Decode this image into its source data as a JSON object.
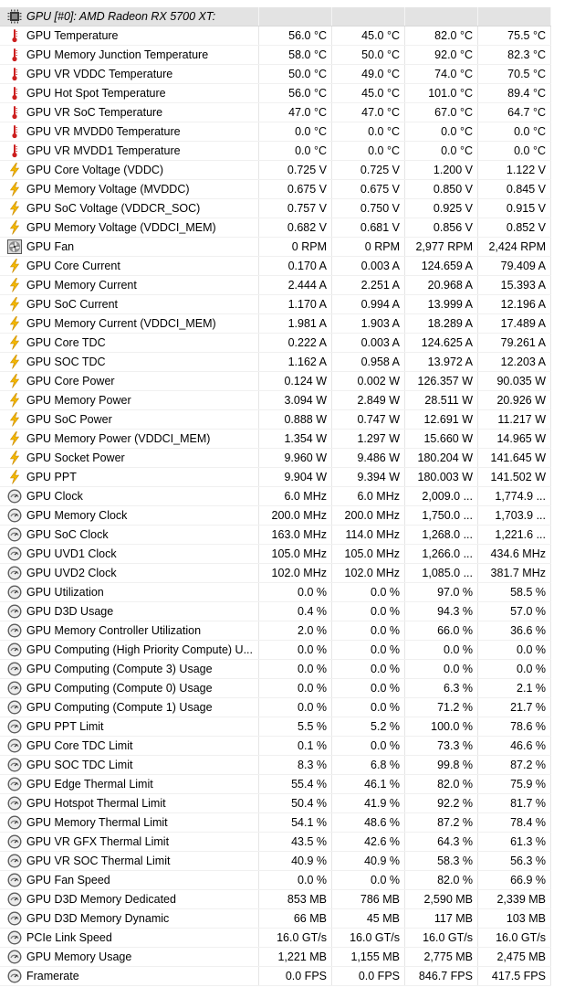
{
  "header": {
    "label": "GPU [#0]: AMD Radeon RX 5700 XT:",
    "icon": "chip-icon"
  },
  "rows": [
    {
      "icon": "thermometer-icon",
      "label": "GPU Temperature",
      "values": [
        "56.0 °C",
        "45.0 °C",
        "82.0 °C",
        "75.5 °C"
      ]
    },
    {
      "icon": "thermometer-icon",
      "label": "GPU Memory Junction Temperature",
      "values": [
        "58.0 °C",
        "50.0 °C",
        "92.0 °C",
        "82.3 °C"
      ]
    },
    {
      "icon": "thermometer-icon",
      "label": "GPU VR VDDC Temperature",
      "values": [
        "50.0 °C",
        "49.0 °C",
        "74.0 °C",
        "70.5 °C"
      ]
    },
    {
      "icon": "thermometer-icon",
      "label": "GPU Hot Spot Temperature",
      "values": [
        "56.0 °C",
        "45.0 °C",
        "101.0 °C",
        "89.4 °C"
      ]
    },
    {
      "icon": "thermometer-icon",
      "label": "GPU VR SoC Temperature",
      "values": [
        "47.0 °C",
        "47.0 °C",
        "67.0 °C",
        "64.7 °C"
      ]
    },
    {
      "icon": "thermometer-icon",
      "label": "GPU VR MVDD0 Temperature",
      "values": [
        "0.0 °C",
        "0.0 °C",
        "0.0 °C",
        "0.0 °C"
      ]
    },
    {
      "icon": "thermometer-icon",
      "label": "GPU VR MVDD1 Temperature",
      "values": [
        "0.0 °C",
        "0.0 °C",
        "0.0 °C",
        "0.0 °C"
      ]
    },
    {
      "icon": "lightning-icon",
      "label": "GPU Core Voltage (VDDC)",
      "values": [
        "0.725 V",
        "0.725 V",
        "1.200 V",
        "1.122 V"
      ]
    },
    {
      "icon": "lightning-icon",
      "label": "GPU Memory Voltage (MVDDC)",
      "values": [
        "0.675 V",
        "0.675 V",
        "0.850 V",
        "0.845 V"
      ]
    },
    {
      "icon": "lightning-icon",
      "label": "GPU SoC Voltage (VDDCR_SOC)",
      "values": [
        "0.757 V",
        "0.750 V",
        "0.925 V",
        "0.915 V"
      ]
    },
    {
      "icon": "lightning-icon",
      "label": "GPU Memory Voltage (VDDCI_MEM)",
      "values": [
        "0.682 V",
        "0.681 V",
        "0.856 V",
        "0.852 V"
      ]
    },
    {
      "icon": "fan-icon",
      "label": "GPU Fan",
      "values": [
        "0 RPM",
        "0 RPM",
        "2,977 RPM",
        "2,424 RPM"
      ]
    },
    {
      "icon": "lightning-icon",
      "label": "GPU Core Current",
      "values": [
        "0.170 A",
        "0.003 A",
        "124.659 A",
        "79.409 A"
      ]
    },
    {
      "icon": "lightning-icon",
      "label": "GPU Memory Current",
      "values": [
        "2.444 A",
        "2.251 A",
        "20.968 A",
        "15.393 A"
      ]
    },
    {
      "icon": "lightning-icon",
      "label": "GPU SoC Current",
      "values": [
        "1.170 A",
        "0.994 A",
        "13.999 A",
        "12.196 A"
      ]
    },
    {
      "icon": "lightning-icon",
      "label": "GPU Memory Current (VDDCI_MEM)",
      "values": [
        "1.981 A",
        "1.903 A",
        "18.289 A",
        "17.489 A"
      ]
    },
    {
      "icon": "lightning-icon",
      "label": "GPU Core TDC",
      "values": [
        "0.222 A",
        "0.003 A",
        "124.625 A",
        "79.261 A"
      ]
    },
    {
      "icon": "lightning-icon",
      "label": "GPU SOC TDC",
      "values": [
        "1.162 A",
        "0.958 A",
        "13.972 A",
        "12.203 A"
      ]
    },
    {
      "icon": "lightning-icon",
      "label": "GPU Core Power",
      "values": [
        "0.124 W",
        "0.002 W",
        "126.357 W",
        "90.035 W"
      ]
    },
    {
      "icon": "lightning-icon",
      "label": "GPU Memory Power",
      "values": [
        "3.094 W",
        "2.849 W",
        "28.511 W",
        "20.926 W"
      ]
    },
    {
      "icon": "lightning-icon",
      "label": "GPU SoC Power",
      "values": [
        "0.888 W",
        "0.747 W",
        "12.691 W",
        "11.217 W"
      ]
    },
    {
      "icon": "lightning-icon",
      "label": "GPU Memory Power (VDDCI_MEM)",
      "values": [
        "1.354 W",
        "1.297 W",
        "15.660 W",
        "14.965 W"
      ]
    },
    {
      "icon": "lightning-icon",
      "label": "GPU Socket Power",
      "values": [
        "9.960 W",
        "9.486 W",
        "180.204 W",
        "141.645 W"
      ]
    },
    {
      "icon": "lightning-icon",
      "label": "GPU PPT",
      "values": [
        "9.904 W",
        "9.394 W",
        "180.003 W",
        "141.502 W"
      ]
    },
    {
      "icon": "gauge-icon",
      "label": "GPU Clock",
      "values": [
        "6.0 MHz",
        "6.0 MHz",
        "2,009.0 ...",
        "1,774.9 ..."
      ]
    },
    {
      "icon": "gauge-icon",
      "label": "GPU Memory Clock",
      "values": [
        "200.0 MHz",
        "200.0 MHz",
        "1,750.0 ...",
        "1,703.9 ..."
      ]
    },
    {
      "icon": "gauge-icon",
      "label": "GPU SoC Clock",
      "values": [
        "163.0 MHz",
        "114.0 MHz",
        "1,268.0 ...",
        "1,221.6 ..."
      ]
    },
    {
      "icon": "gauge-icon",
      "label": "GPU UVD1 Clock",
      "values": [
        "105.0 MHz",
        "105.0 MHz",
        "1,266.0 ...",
        "434.6 MHz"
      ]
    },
    {
      "icon": "gauge-icon",
      "label": "GPU UVD2 Clock",
      "values": [
        "102.0 MHz",
        "102.0 MHz",
        "1,085.0 ...",
        "381.7 MHz"
      ]
    },
    {
      "icon": "gauge-icon",
      "label": "GPU Utilization",
      "values": [
        "0.0 %",
        "0.0 %",
        "97.0 %",
        "58.5 %"
      ]
    },
    {
      "icon": "gauge-icon",
      "label": "GPU D3D Usage",
      "values": [
        "0.4 %",
        "0.0 %",
        "94.3 %",
        "57.0 %"
      ]
    },
    {
      "icon": "gauge-icon",
      "label": "GPU Memory Controller Utilization",
      "values": [
        "2.0 %",
        "0.0 %",
        "66.0 %",
        "36.6 %"
      ]
    },
    {
      "icon": "gauge-icon",
      "label": "GPU Computing (High Priority Compute) U...",
      "values": [
        "0.0 %",
        "0.0 %",
        "0.0 %",
        "0.0 %"
      ]
    },
    {
      "icon": "gauge-icon",
      "label": "GPU Computing (Compute 3) Usage",
      "values": [
        "0.0 %",
        "0.0 %",
        "0.0 %",
        "0.0 %"
      ]
    },
    {
      "icon": "gauge-icon",
      "label": "GPU Computing (Compute 0) Usage",
      "values": [
        "0.0 %",
        "0.0 %",
        "6.3 %",
        "2.1 %"
      ]
    },
    {
      "icon": "gauge-icon",
      "label": "GPU Computing (Compute 1) Usage",
      "values": [
        "0.0 %",
        "0.0 %",
        "71.2 %",
        "21.7 %"
      ]
    },
    {
      "icon": "gauge-icon",
      "label": "GPU PPT Limit",
      "values": [
        "5.5 %",
        "5.2 %",
        "100.0 %",
        "78.6 %"
      ]
    },
    {
      "icon": "gauge-icon",
      "label": "GPU Core TDC Limit",
      "values": [
        "0.1 %",
        "0.0 %",
        "73.3 %",
        "46.6 %"
      ]
    },
    {
      "icon": "gauge-icon",
      "label": "GPU SOC TDC Limit",
      "values": [
        "8.3 %",
        "6.8 %",
        "99.8 %",
        "87.2 %"
      ]
    },
    {
      "icon": "gauge-icon",
      "label": "GPU Edge Thermal Limit",
      "values": [
        "55.4 %",
        "46.1 %",
        "82.0 %",
        "75.9 %"
      ]
    },
    {
      "icon": "gauge-icon",
      "label": "GPU Hotspot Thermal Limit",
      "values": [
        "50.4 %",
        "41.9 %",
        "92.2 %",
        "81.7 %"
      ]
    },
    {
      "icon": "gauge-icon",
      "label": "GPU Memory Thermal Limit",
      "values": [
        "54.1 %",
        "48.6 %",
        "87.2 %",
        "78.4 %"
      ]
    },
    {
      "icon": "gauge-icon",
      "label": "GPU VR GFX Thermal Limit",
      "values": [
        "43.5 %",
        "42.6 %",
        "64.3 %",
        "61.3 %"
      ]
    },
    {
      "icon": "gauge-icon",
      "label": "GPU VR SOC Thermal Limit",
      "values": [
        "40.9 %",
        "40.9 %",
        "58.3 %",
        "56.3 %"
      ]
    },
    {
      "icon": "gauge-icon",
      "label": "GPU Fan Speed",
      "values": [
        "0.0 %",
        "0.0 %",
        "82.0 %",
        "66.9 %"
      ]
    },
    {
      "icon": "gauge-icon",
      "label": "GPU D3D Memory Dedicated",
      "values": [
        "853 MB",
        "786 MB",
        "2,590 MB",
        "2,339 MB"
      ]
    },
    {
      "icon": "gauge-icon",
      "label": "GPU D3D Memory Dynamic",
      "values": [
        "66 MB",
        "45 MB",
        "117 MB",
        "103 MB"
      ]
    },
    {
      "icon": "gauge-icon",
      "label": "PCIe Link Speed",
      "values": [
        "16.0 GT/s",
        "16.0 GT/s",
        "16.0 GT/s",
        "16.0 GT/s"
      ]
    },
    {
      "icon": "gauge-icon",
      "label": "GPU Memory Usage",
      "values": [
        "1,221 MB",
        "1,155 MB",
        "2,775 MB",
        "2,475 MB"
      ]
    },
    {
      "icon": "gauge-icon",
      "label": "Framerate",
      "values": [
        "0.0 FPS",
        "0.0 FPS",
        "846.7 FPS",
        "417.5 FPS"
      ]
    }
  ],
  "colors": {
    "thermometer": "#cc1f1f",
    "lightning": "#f2b705",
    "gauge": "#707070",
    "header_bg": "#e3e3e3"
  }
}
